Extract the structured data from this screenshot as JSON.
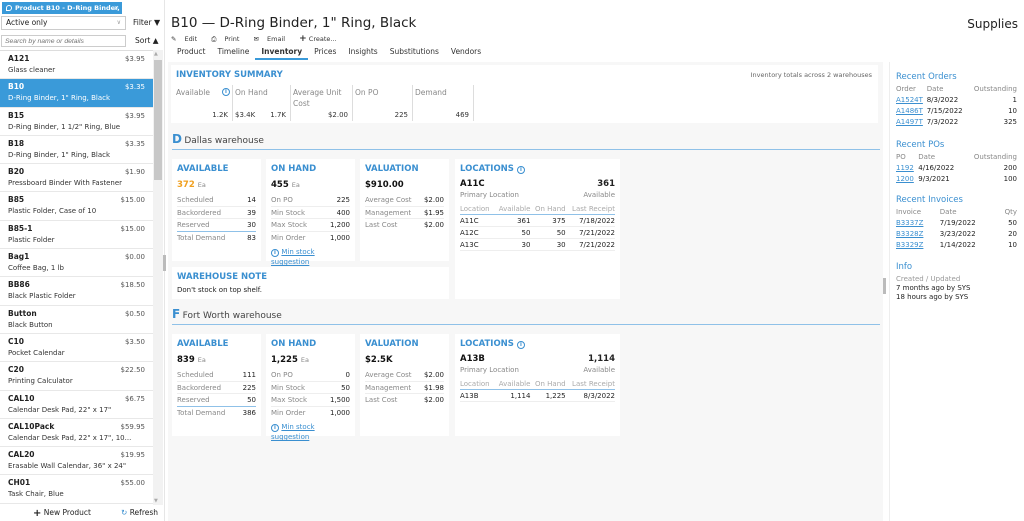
{
  "product_tab": {
    "label": "Product B10 - D-Ring Binder, ..."
  },
  "filter": {
    "selected": "Active only",
    "filter_label": "Filter",
    "sort_label": "Sort ▲",
    "search_placeholder": "Search by name or details"
  },
  "products": [
    {
      "code": "A121",
      "price": "$3.95",
      "desc": "Glass cleaner",
      "selected": false
    },
    {
      "code": "B10",
      "price": "$3.35",
      "desc": "D-Ring Binder, 1\" Ring, Black",
      "selected": true
    },
    {
      "code": "B15",
      "price": "$3.95",
      "desc": "D-Ring Binder, 1 1/2\" Ring, Blue",
      "selected": false
    },
    {
      "code": "B18",
      "price": "$3.35",
      "desc": "D-Ring Binder, 1\" Ring, Black",
      "selected": false
    },
    {
      "code": "B20",
      "price": "$1.90",
      "desc": "Pressboard Binder With Fastener",
      "selected": false
    },
    {
      "code": "B85",
      "price": "$15.00",
      "desc": "Plastic Folder, Case of 10",
      "selected": false
    },
    {
      "code": "B85-1",
      "price": "$15.00",
      "desc": "Plastic Folder",
      "selected": false
    },
    {
      "code": "Bag1",
      "price": "$0.00",
      "desc": "Coffee Bag, 1 lb",
      "selected": false
    },
    {
      "code": "BB86",
      "price": "$18.50",
      "desc": "Black Plastic Folder",
      "selected": false
    },
    {
      "code": "Button",
      "price": "$0.50",
      "desc": "Black Button",
      "selected": false
    },
    {
      "code": "C10",
      "price": "$3.50",
      "desc": "Pocket Calendar",
      "selected": false
    },
    {
      "code": "C20",
      "price": "$22.50",
      "desc": "Printing Calculator",
      "selected": false
    },
    {
      "code": "CAL10",
      "price": "$6.75",
      "desc": "Calendar Desk Pad, 22\" x 17\"",
      "selected": false
    },
    {
      "code": "CAL10Pack",
      "price": "$59.95",
      "desc": "Calendar Desk Pad, 22\" x 17\", 10...",
      "selected": false
    },
    {
      "code": "CAL20",
      "price": "$19.95",
      "desc": "Erasable Wall Calendar, 36\" x 24\"",
      "selected": false
    },
    {
      "code": "CH01",
      "price": "$55.00",
      "desc": "Task Chair, Blue",
      "selected": false
    }
  ],
  "footer": {
    "new_product": "New Product",
    "refresh": "Refresh"
  },
  "header": {
    "title": "B10 — D-Ring Binder, 1\" Ring, Black",
    "app_name": "Supplies"
  },
  "actions": {
    "edit": "Edit",
    "print": "Print",
    "email": "Email",
    "create": "Create..."
  },
  "tabs": [
    "Product",
    "Timeline",
    "Inventory",
    "Prices",
    "Insights",
    "Substitutions",
    "Vendors"
  ],
  "active_tab": "Inventory",
  "summary": {
    "title": "INVENTORY SUMMARY",
    "note": "Inventory totals across 2 warehouses",
    "cols": [
      {
        "label": "Available",
        "value": "1.2K"
      },
      {
        "label": "On Hand",
        "value": "1.7K",
        "sub": "$3.4K"
      },
      {
        "label": "Average Unit Cost",
        "value": "$2.00"
      },
      {
        "label": "On PO",
        "value": "225"
      },
      {
        "label": "Demand",
        "value": "469"
      }
    ]
  },
  "warehouses": [
    {
      "letter": "D",
      "name": "Dallas warehouse",
      "available": {
        "title": "AVAILABLE",
        "value": "372",
        "unit": "Ea",
        "rows": [
          [
            "Scheduled",
            "14"
          ],
          [
            "Backordered",
            "39"
          ],
          [
            "Reserved",
            "30"
          ],
          [
            "Total Demand",
            "83"
          ]
        ]
      },
      "on_hand": {
        "title": "ON HAND",
        "value": "455",
        "unit": "Ea",
        "rows": [
          [
            "On PO",
            "225"
          ],
          [
            "Min Stock",
            "400"
          ],
          [
            "Max Stock",
            "1,200"
          ],
          [
            "Min Order",
            "1,000"
          ]
        ],
        "link": "Min stock suggestion"
      },
      "valuation": {
        "title": "VALUATION",
        "value": "$910.00",
        "rows": [
          [
            "Average Cost",
            "$2.00"
          ],
          [
            "Management",
            "$1.95"
          ],
          [
            "Last Cost",
            "$2.00"
          ]
        ]
      },
      "locations": {
        "title": "LOCATIONS",
        "primary": "A11C",
        "primary_available": "361",
        "primary_label": "Primary Location",
        "available_label": "Available",
        "headers": [
          "Location",
          "Available",
          "On Hand",
          "Last Receipt"
        ],
        "rows": [
          [
            "A11C",
            "361",
            "375",
            "7/18/2022"
          ],
          [
            "A12C",
            "50",
            "50",
            "7/21/2022"
          ],
          [
            "A13C",
            "30",
            "30",
            "7/21/2022"
          ]
        ]
      },
      "note": {
        "title": "WAREHOUSE NOTE",
        "text": "Don't stock on top shelf."
      }
    },
    {
      "letter": "F",
      "name": "Fort Worth warehouse",
      "available": {
        "title": "AVAILABLE",
        "value": "839",
        "unit": "Ea",
        "rows": [
          [
            "Scheduled",
            "111"
          ],
          [
            "Backordered",
            "225"
          ],
          [
            "Reserved",
            "50"
          ],
          [
            "Total Demand",
            "386"
          ]
        ]
      },
      "on_hand": {
        "title": "ON HAND",
        "value": "1,225",
        "unit": "Ea",
        "rows": [
          [
            "On PO",
            "0"
          ],
          [
            "Min Stock",
            "50"
          ],
          [
            "Max Stock",
            "1,500"
          ],
          [
            "Min Order",
            "1,000"
          ]
        ],
        "link": "Min stock suggestion"
      },
      "valuation": {
        "title": "VALUATION",
        "value": "$2.5K",
        "rows": [
          [
            "Average Cost",
            "$2.00"
          ],
          [
            "Management",
            "$1.98"
          ],
          [
            "Last Cost",
            "$2.00"
          ]
        ]
      },
      "locations": {
        "title": "LOCATIONS",
        "primary": "A13B",
        "primary_available": "1,114",
        "primary_label": "Primary Location",
        "available_label": "Available",
        "headers": [
          "Location",
          "Available",
          "On Hand",
          "Last Receipt"
        ],
        "rows": [
          [
            "A13B",
            "1,114",
            "1,225",
            "8/3/2022"
          ]
        ]
      }
    }
  ],
  "right": {
    "recent_orders": {
      "title": "Recent Orders",
      "headers": [
        "Order",
        "Date",
        "Outstanding"
      ],
      "rows": [
        [
          "A1524T",
          "8/3/2022",
          "1"
        ],
        [
          "A1486T",
          "7/15/2022",
          "10"
        ],
        [
          "A1497T",
          "7/3/2022",
          "325"
        ]
      ]
    },
    "recent_pos": {
      "title": "Recent POs",
      "headers": [
        "PO",
        "Date",
        "Outstanding"
      ],
      "rows": [
        [
          "1192",
          "4/16/2022",
          "200"
        ],
        [
          "1200",
          "9/3/2021",
          "100"
        ]
      ]
    },
    "recent_invoices": {
      "title": "Recent Invoices",
      "headers": [
        "Invoice",
        "Date",
        "Qty"
      ],
      "rows": [
        [
          "B3337Z",
          "7/19/2022",
          "50"
        ],
        [
          "B3328Z",
          "3/23/2022",
          "20"
        ],
        [
          "B3329Z",
          "1/14/2022",
          "10"
        ]
      ]
    },
    "info": {
      "title": "Info",
      "label": "Created / Updated",
      "created": "7 months ago by SYS",
      "updated": "18 hours ago by SYS"
    }
  }
}
